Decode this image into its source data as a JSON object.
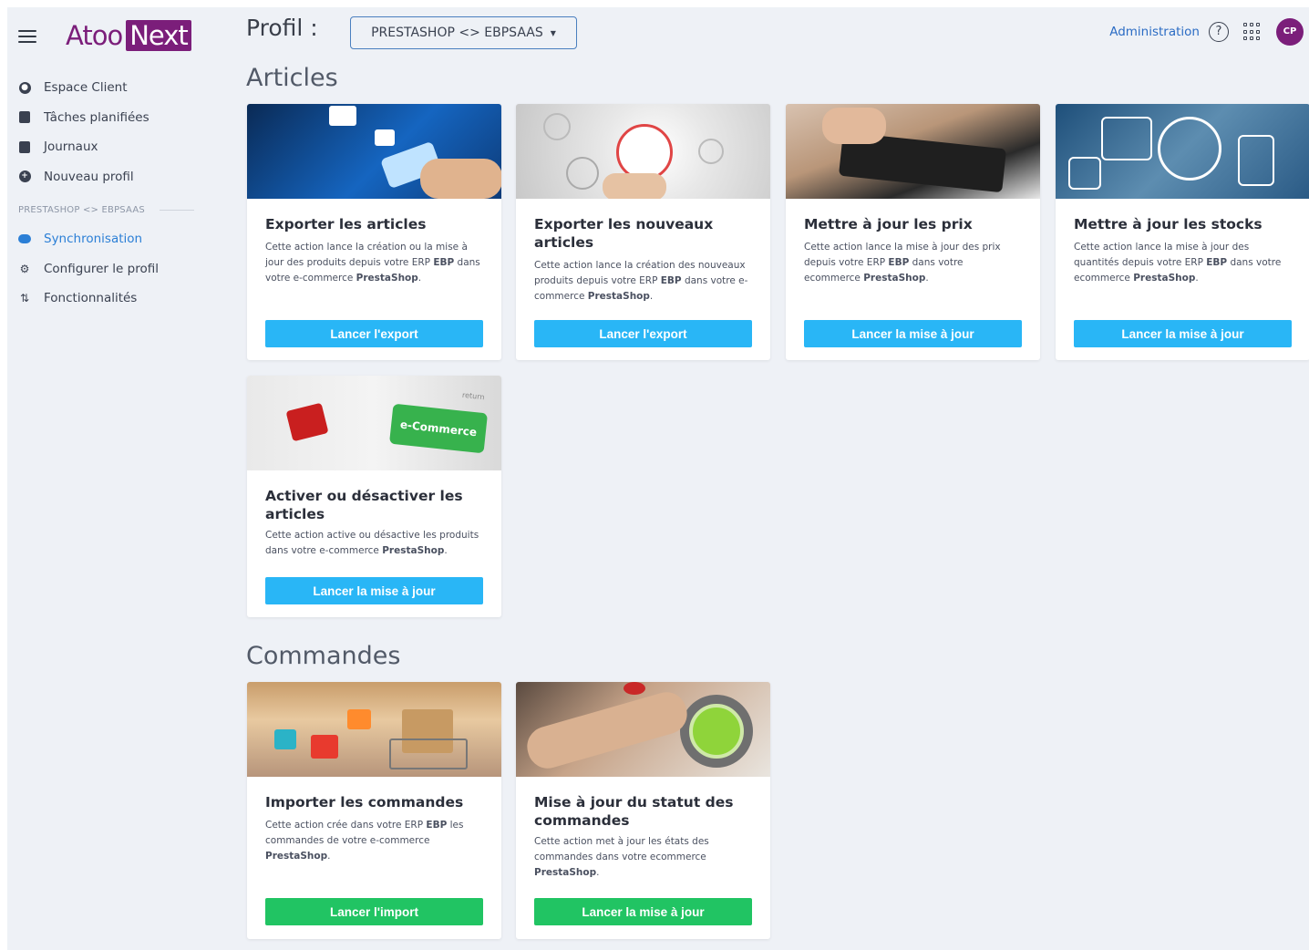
{
  "brand": {
    "name_part1": "Atoo",
    "name_part2": "Next"
  },
  "sidebar": {
    "items": [
      {
        "label": "Espace Client",
        "icon": "user-circle-icon"
      },
      {
        "label": "Tâches planifiées",
        "icon": "calendar-check-icon"
      },
      {
        "label": "Journaux",
        "icon": "file-log-icon"
      },
      {
        "label": "Nouveau profil",
        "icon": "plus-circle-icon"
      }
    ],
    "section_label": "PRESTASHOP <> EBPSAAS",
    "profile_items": [
      {
        "label": "Synchronisation",
        "icon": "cloud-icon",
        "active": true
      },
      {
        "label": "Configurer le profil",
        "icon": "gears-icon"
      },
      {
        "label": "Fonctionnalités",
        "icon": "sort-arrows-icon"
      }
    ]
  },
  "header": {
    "profil_label": "Profil :",
    "profile_select": "PRESTASHOP <> EBPSAAS",
    "admin_link": "Administration",
    "help": "?",
    "avatar_initials": "CP"
  },
  "sections": {
    "articles": "Articles",
    "commandes": "Commandes"
  },
  "cards": {
    "export_articles": {
      "title": "Exporter les articles",
      "desc_pre": "Cette action lance la création ou la mise à jour des produits depuis votre ERP ",
      "erp": "EBP",
      "desc_mid": " dans votre e-commerce ",
      "shop": "PrestaShop",
      "desc_end": ".",
      "button": "Lancer l'export"
    },
    "export_new": {
      "title": "Exporter les nouveaux articles",
      "desc_pre": "Cette action lance la création des nouveaux produits depuis votre ERP ",
      "erp": "EBP",
      "desc_mid": " dans votre e-commerce ",
      "shop": "PrestaShop",
      "desc_end": ".",
      "button": "Lancer l'export"
    },
    "update_prices": {
      "title": "Mettre à jour les prix",
      "desc_pre": "Cette action lance la mise à jour des prix depuis votre ERP ",
      "erp": "EBP",
      "desc_mid": " dans votre ecommerce ",
      "shop": "PrestaShop",
      "desc_end": ".",
      "button": "Lancer la mise à jour"
    },
    "update_stocks": {
      "title": "Mettre à jour les stocks",
      "desc_pre": "Cette action lance la mise à jour des quantités depuis votre ERP ",
      "erp": "EBP",
      "desc_mid": " dans votre ecommerce ",
      "shop": "PrestaShop",
      "desc_end": ".",
      "button": "Lancer la mise à jour"
    },
    "toggle_articles": {
      "title": "Activer ou désactiver les articles",
      "desc_pre": "Cette action active ou désactive les produits dans votre e-commerce ",
      "shop": "PrestaShop",
      "desc_end": ".",
      "button": "Lancer la mise à jour",
      "image_key_label": "e-Commerce",
      "image_key_small": "return"
    },
    "import_orders": {
      "title": "Importer les commandes",
      "desc_pre": "Cette action crée dans votre ERP ",
      "erp": "EBP",
      "desc_mid": " les commandes de votre e-commerce ",
      "shop": "PrestaShop",
      "desc_end": ".",
      "button": "Lancer l'import"
    },
    "update_order_status": {
      "title": "Mise à jour du statut des commandes",
      "desc_pre": "Cette action met à jour les états des commandes dans votre ecommerce ",
      "shop": "PrestaShop",
      "desc_end": ".",
      "button": "Lancer la mise à jour"
    }
  },
  "colors": {
    "brand": "#7b1e7a",
    "button_blue": "#29b6f6",
    "button_green": "#21c463",
    "link": "#2b6cc4"
  }
}
